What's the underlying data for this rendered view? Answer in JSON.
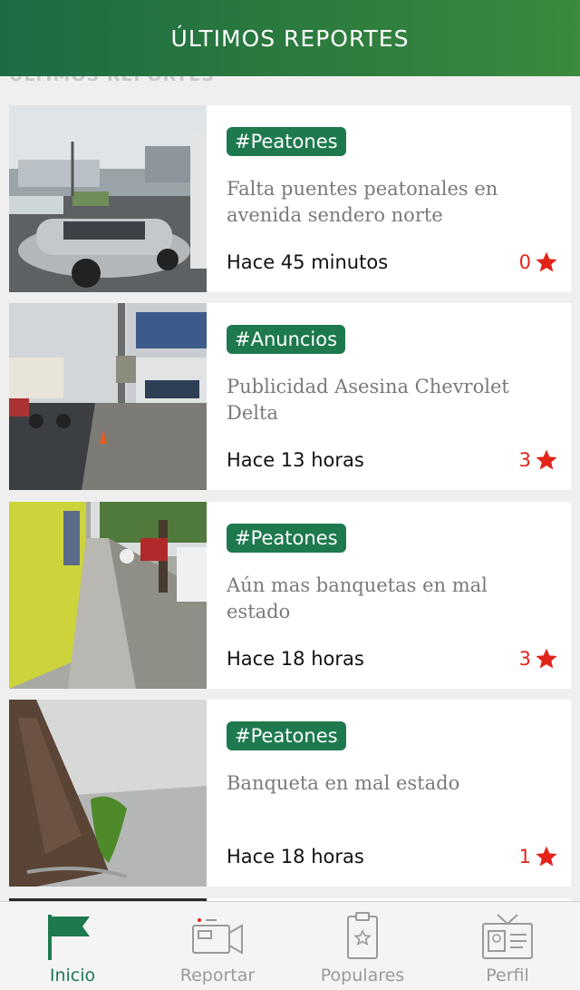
{
  "header": {
    "title": "ÚLTIMOS REPORTES"
  },
  "section": {
    "heading": "ÚLTIMOS REPORTES"
  },
  "reports": [
    {
      "tag": "#Peatones",
      "title": "Falta puentes peatonales en avenida sendero norte",
      "time": "Hace 45 minutos",
      "stars": "0",
      "image": "street-traffic-photo"
    },
    {
      "tag": "#Anuncios",
      "title": "Publicidad Asesina Chevrolet Delta",
      "time": "Hace 13 horas",
      "stars": "3",
      "image": "sidewalk-billboard-photo"
    },
    {
      "tag": "#Peatones",
      "title": "Aún mas banquetas en mal estado",
      "time": "Hace 18 horas",
      "stars": "3",
      "image": "yellow-wall-sidewalk-photo"
    },
    {
      "tag": "#Peatones",
      "title": "Banqueta en mal estado",
      "time": "Hace 18 horas",
      "stars": "1",
      "image": "tree-trunk-sidewalk-photo"
    }
  ],
  "tabs": [
    {
      "label": "Inicio",
      "icon": "flag-icon",
      "active": true
    },
    {
      "label": "Reportar",
      "icon": "video-camera-icon",
      "active": false
    },
    {
      "label": "Populares",
      "icon": "clipboard-star-icon",
      "active": false
    },
    {
      "label": "Perfil",
      "icon": "id-card-icon",
      "active": false
    }
  ],
  "colors": {
    "accent": "#1e7a4e",
    "header": "#2e7d3e",
    "star": "#e3241b",
    "inactive": "#9a9a9a"
  }
}
